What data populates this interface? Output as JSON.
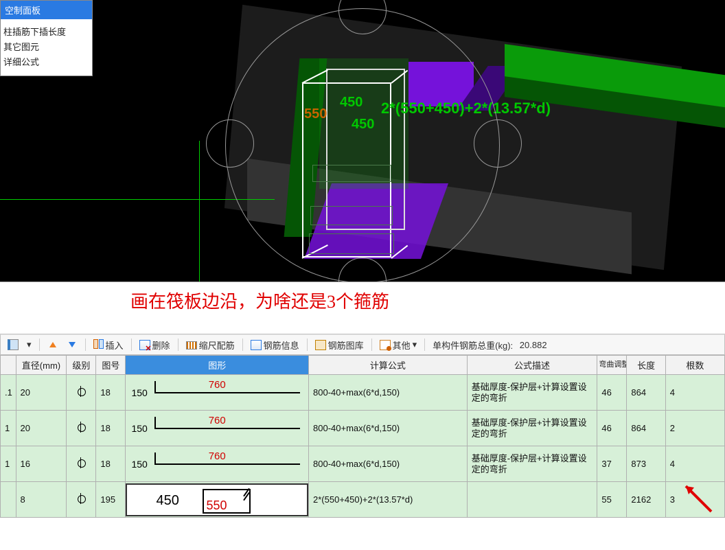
{
  "controlPanel": {
    "title": "空制面板",
    "items": [
      "",
      "",
      "柱插筋下插长度",
      "其它图元",
      "详细公式"
    ]
  },
  "viewportDims": {
    "d1": "450",
    "d2": "450",
    "formula": "2*(550+450)+2*(13.57*d)",
    "left": "550"
  },
  "annotation": "画在筏板边沿，为啥还是3个箍筋",
  "toolbar": {
    "insert": "插入",
    "delete": "删除",
    "scale": "缩尺配筋",
    "info": "钢筋信息",
    "lib": "钢筋图库",
    "other": "其他",
    "weightLabel": "单构件钢筋总重(kg):",
    "weightValue": "20.882"
  },
  "columns": {
    "c0": "",
    "diameter": "直径(mm)",
    "level": "级别",
    "shapeNum": "图号",
    "shape": "图形",
    "formula": "计算公式",
    "desc": "公式描述",
    "bend": "弯曲调整",
    "length": "长度",
    "count": "根数"
  },
  "rows": [
    {
      "idx": ".1",
      "dia": "20",
      "shapeNum": "18",
      "leftNum": "150",
      "redNum": "760",
      "formula": "800-40+max(6*d,150)",
      "desc": "基础厚度-保护层+计算设置设定的弯折",
      "bend": "46",
      "len": "864",
      "count": "4"
    },
    {
      "idx": "1",
      "dia": "20",
      "shapeNum": "18",
      "leftNum": "150",
      "redNum": "760",
      "formula": "800-40+max(6*d,150)",
      "desc": "基础厚度-保护层+计算设置设定的弯折",
      "bend": "46",
      "len": "864",
      "count": "2"
    },
    {
      "idx": "1",
      "dia": "16",
      "shapeNum": "18",
      "leftNum": "150",
      "redNum": "760",
      "formula": "800-40+max(6*d,150)",
      "desc": "基础厚度-保护层+计算设置设定的弯折",
      "bend": "37",
      "len": "873",
      "count": "4"
    },
    {
      "idx": "",
      "dia": "8",
      "shapeNum": "195",
      "leftNum": "450",
      "redNum": "550",
      "formula": "2*(550+450)+2*(13.57*d)",
      "desc": "",
      "bend": "55",
      "len": "2162",
      "count": "3",
      "stirrup": true
    }
  ]
}
